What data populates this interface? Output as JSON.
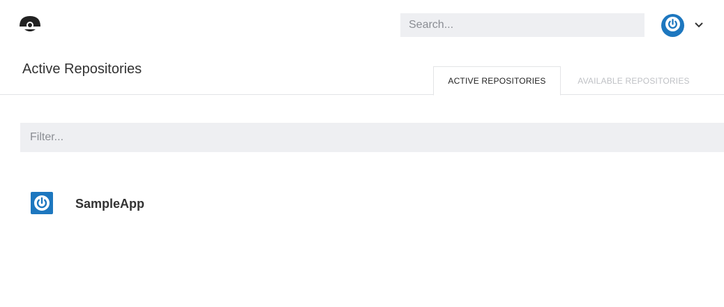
{
  "header": {
    "logo_icon": "drone-logo-icon",
    "search_placeholder": "Search...",
    "avatar_icon": "power-icon",
    "menu_icon": "chevron-down-icon"
  },
  "page": {
    "title": "Active Repositories",
    "tabs": [
      {
        "label": "ACTIVE REPOSITORIES",
        "active": true
      },
      {
        "label": "AVAILABLE REPOSITORIES",
        "active": false
      }
    ]
  },
  "filter": {
    "placeholder": "Filter..."
  },
  "repositories": [
    {
      "name": "SampleApp",
      "icon": "power-icon"
    }
  ],
  "colors": {
    "accent": "#1d77bf",
    "input_bg": "#eeeff2",
    "border": "#e3e4e6",
    "inactive_tab_text": "#bfc1c5"
  }
}
